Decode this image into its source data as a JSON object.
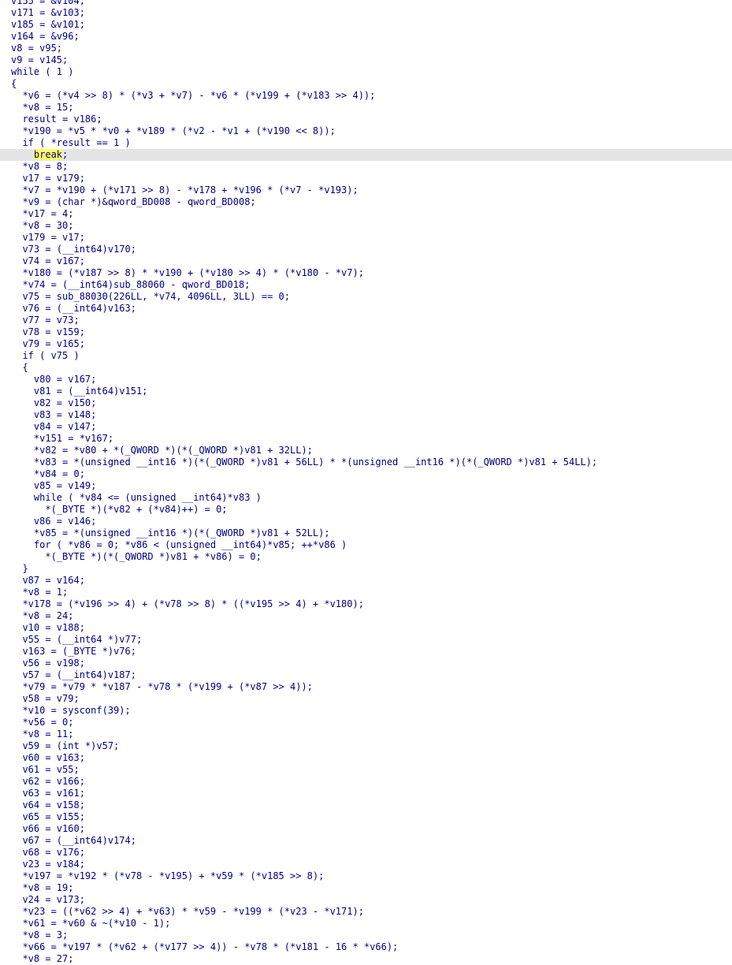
{
  "editor": {
    "current_line_index": 13,
    "colors": {
      "text": "#000080",
      "background": "#ffffff",
      "current_line": "#e5e5e5",
      "highlight": "#ffff66"
    },
    "lines": [
      "v155 = &v104;",
      "v171 = &v103;",
      "v185 = &v101;",
      "v164 = &v96;",
      "v8 = v95;",
      "v9 = v145;",
      "while ( 1 )",
      "{",
      "  *v6 = (*v4 >> 8) * (*v3 + *v7) - *v6 * (*v199 + (*v183 >> 4));",
      "  *v8 = 15;",
      "  result = v186;",
      "  *v190 = *v5 * *v0 + *v189 * (*v2 - *v1 + (*v190 << 8));",
      "  if ( *result == 1 )",
      "    break;",
      "  *v8 = 8;",
      "  v17 = v179;",
      "  *v7 = *v190 + (*v171 >> 8) - *v178 + *v196 * (*v7 - *v193);",
      "  *v9 = (char *)&qword_BD008 - qword_BD008;",
      "  *v17 = 4;",
      "  *v8 = 30;",
      "  v179 = v17;",
      "  v73 = (__int64)v170;",
      "  v74 = v167;",
      "  *v180 = (*v187 >> 8) * *v190 + (*v180 >> 4) * (*v180 - *v7);",
      "  *v74 = (__int64)sub_88060 - qword_BD018;",
      "  v75 = sub_88030(226LL, *v74, 4096LL, 3LL) == 0;",
      "  v76 = (__int64)v163;",
      "  v77 = v73;",
      "  v78 = v159;",
      "  v79 = v165;",
      "  if ( v75 )",
      "  {",
      "    v80 = v167;",
      "    v81 = (__int64)v151;",
      "    v82 = v150;",
      "    v83 = v148;",
      "    v84 = v147;",
      "    *v151 = *v167;",
      "    *v82 = *v80 + *(_QWORD *)(*(_QWORD *)v81 + 32LL);",
      "    *v83 = *(unsigned __int16 *)(*(_QWORD *)v81 + 56LL) * *(unsigned __int16 *)(*(_QWORD *)v81 + 54LL);",
      "    *v84 = 0;",
      "    v85 = v149;",
      "    while ( *v84 <= (unsigned __int64)*v83 )",
      "      *(_BYTE *)(*v82 + (*v84)++) = 0;",
      "    v86 = v146;",
      "    *v85 = *(unsigned __int16 *)(*(_QWORD *)v81 + 52LL);",
      "    for ( *v86 = 0; *v86 < (unsigned __int64)*v85; ++*v86 )",
      "      *(_BYTE *)(*(_QWORD *)v81 + *v86) = 0;",
      "  }",
      "  v87 = v164;",
      "  *v8 = 1;",
      "  *v178 = (*v196 >> 4) + (*v78 >> 8) * ((*v195 >> 4) + *v180);",
      "  *v8 = 24;",
      "  v10 = v188;",
      "  v55 = (__int64 *)v77;",
      "  v163 = (_BYTE *)v76;",
      "  v56 = v198;",
      "  v57 = (__int64)v187;",
      "  *v79 = *v79 * *v187 - *v78 * (*v199 + (*v87 >> 4));",
      "  v58 = v79;",
      "  *v10 = sysconf(39);",
      "  *v56 = 0;",
      "  *v8 = 11;",
      "  v59 = (int *)v57;",
      "  v60 = v163;",
      "  v61 = v55;",
      "  v62 = v166;",
      "  v63 = v161;",
      "  v64 = v158;",
      "  v65 = v155;",
      "  v66 = v160;",
      "  v67 = (__int64)v174;",
      "  v68 = v176;",
      "  v23 = v184;",
      "  *v197 = *v192 * (*v78 - *v195) + *v59 * (*v185 >> 8);",
      "  *v8 = 19;",
      "  v24 = v173;",
      "  *v23 = ((*v62 >> 4) + *v63) * *v59 - *v199 * (*v23 - *v171);",
      "  *v61 = *v60 & ~(*v10 - 1);",
      "  *v8 = 3;",
      "  *v66 = *v197 * (*v62 + (*v177 >> 4)) - *v78 * (*v181 - 16 * *v66);",
      "  *v8 = 27;"
    ]
  }
}
